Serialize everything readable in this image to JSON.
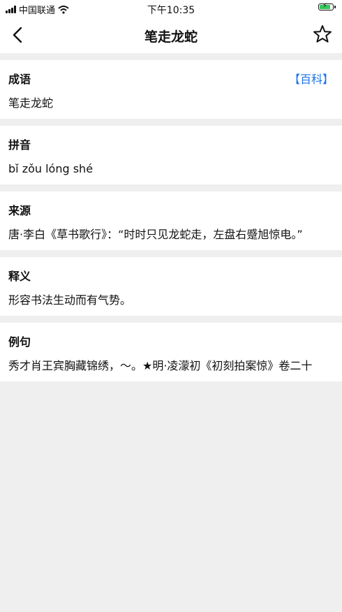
{
  "status": {
    "carrier": "中国联通",
    "time": "下午10:35"
  },
  "nav": {
    "title": "笔走龙蛇"
  },
  "sections": [
    {
      "title": "成语",
      "link": "【百科】",
      "body": "笔走龙蛇"
    },
    {
      "title": "拼音",
      "body": "bǐ zǒu lóng shé"
    },
    {
      "title": "来源",
      "body": "唐·李白《草书歌行》：“时时只见龙蛇走，左盘右蹙旭惊电。”"
    },
    {
      "title": "释义",
      "body": "形容书法生动而有气势。"
    },
    {
      "title": "例句",
      "body": "秀才肖王宾胸藏锦绣，～。★明·凌濛初《初刻拍案惊》卷二十"
    }
  ],
  "icons": {
    "back": "back-arrow-icon",
    "favorite": "star-icon",
    "signal": "signal-icon",
    "wifi": "wifi-icon",
    "battery": "battery-icon"
  },
  "colors": {
    "accent": "#1a73e8",
    "background": "#efefef",
    "battery": "#34c759"
  }
}
